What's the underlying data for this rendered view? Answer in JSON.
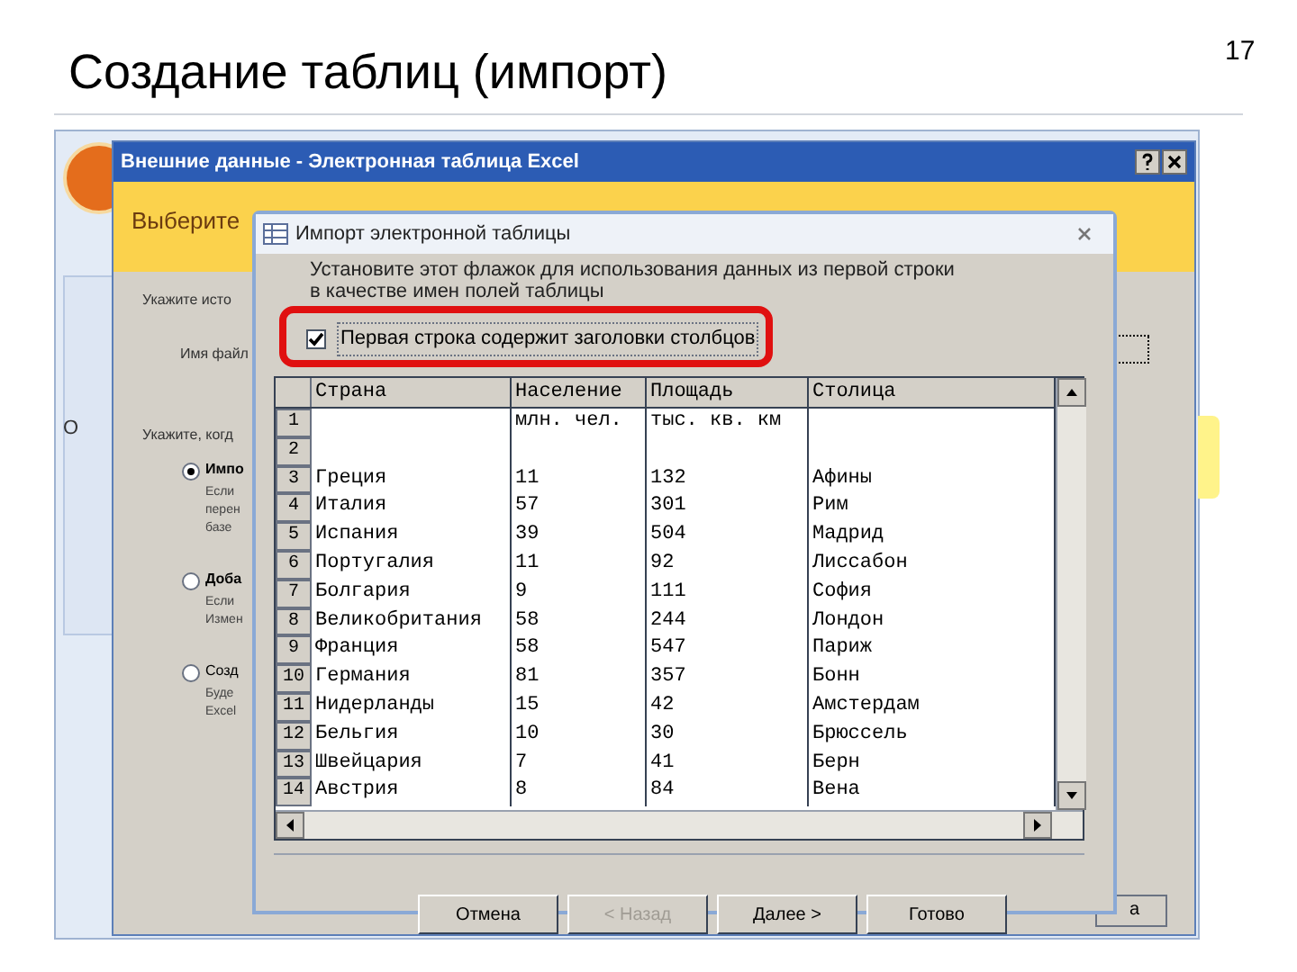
{
  "slide": {
    "title": "Создание таблиц (импорт)",
    "page_number": "17"
  },
  "access_window": {
    "side_label": "О"
  },
  "external_data_dialog": {
    "title": "Внешние данные - Электронная таблица Excel",
    "heading": "Выберите",
    "labels": [
      "Укажите исто",
      "Имя файл",
      "Укажите, когд"
    ],
    "options": [
      {
        "label": "Импо",
        "selected": true,
        "description": [
          "Если",
          "перен",
          "базе"
        ]
      },
      {
        "label": "Доба",
        "selected": false,
        "description": [
          "Если",
          "Измен"
        ]
      },
      {
        "label": "Созд",
        "selected": false,
        "description": [
          "Буде",
          "Excel"
        ]
      }
    ],
    "corner_button": "а"
  },
  "import_dialog": {
    "title": "Импорт электронной таблицы",
    "instruction": [
      "Установите этот флажок для использования данных из первой строки",
      "в качестве имен полей таблицы"
    ],
    "checkbox": {
      "label": "Первая строка содержит заголовки столбцов",
      "checked": true
    },
    "columns": [
      "Страна",
      "Население",
      "Площадь",
      "Столица"
    ],
    "rows": [
      {
        "number": "1",
        "population": "млн. чел.",
        "area": "тыс. кв. км"
      },
      {
        "number": "2"
      },
      {
        "number": "3",
        "country": "Греция",
        "population": "11",
        "area": "132",
        "capital": "Афины"
      },
      {
        "number": "4",
        "country": "Италия",
        "population": "57",
        "area": "301",
        "capital": "Рим"
      },
      {
        "number": "5",
        "country": "Испания",
        "population": "39",
        "area": "504",
        "capital": "Мадрид"
      },
      {
        "number": "6",
        "country": "Португалия",
        "population": "11",
        "area": "92",
        "capital": "Лиссабон"
      },
      {
        "number": "7",
        "country": "Болгария",
        "population": "9",
        "area": "111",
        "capital": "София"
      },
      {
        "number": "8",
        "country": "Великобритания",
        "population": "58",
        "area": "244",
        "capital": "Лондон"
      },
      {
        "number": "9",
        "country": "Франция",
        "population": "58",
        "area": "547",
        "capital": "Париж"
      },
      {
        "number": "10",
        "country": "Германия",
        "population": "81",
        "area": "357",
        "capital": "Бонн"
      },
      {
        "number": "11",
        "country": "Нидерланды",
        "population": "15",
        "area": "42",
        "capital": "Амстердам"
      },
      {
        "number": "12",
        "country": "Бельгия",
        "population": "10",
        "area": "30",
        "capital": "Брюссель"
      },
      {
        "number": "13",
        "country": "Швейцария",
        "population": "7",
        "area": "41",
        "capital": "Берн"
      },
      {
        "number": "14",
        "country": "Австрия",
        "population": "8",
        "area": "84",
        "capital": "Вена"
      }
    ],
    "buttons": [
      {
        "label": "Отмена",
        "disabled": false
      },
      {
        "label": "< Назад",
        "disabled": true
      },
      {
        "label": "Далее >",
        "disabled": false
      },
      {
        "label": "Готово",
        "disabled": false
      }
    ]
  }
}
